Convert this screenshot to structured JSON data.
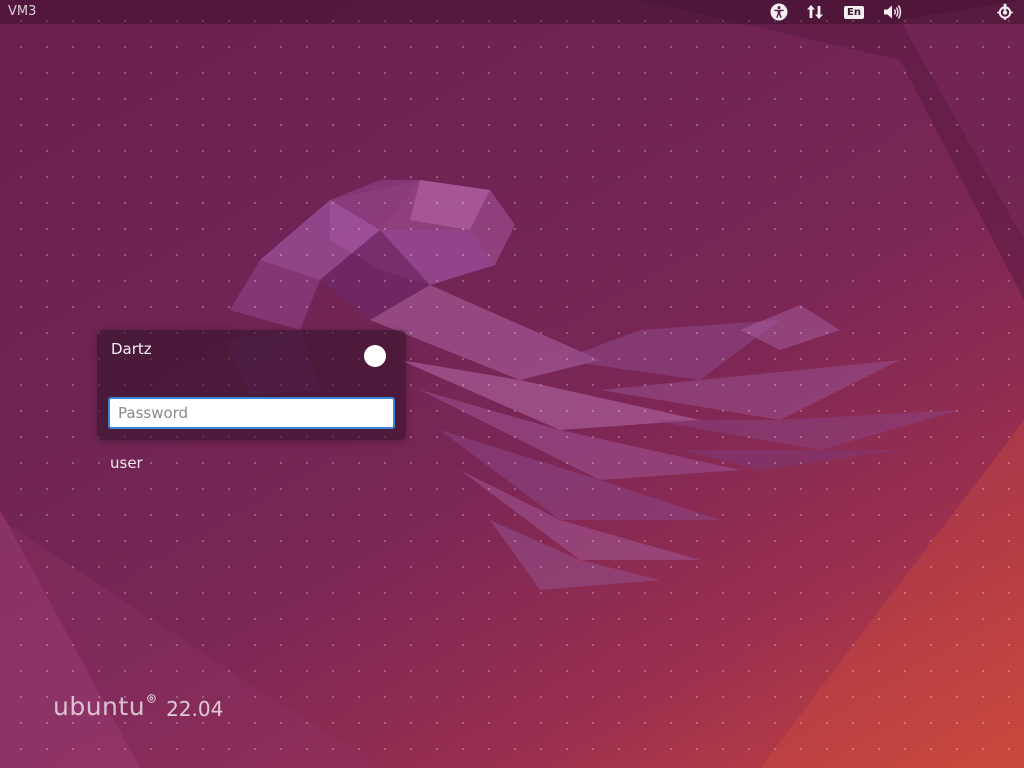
{
  "top_panel": {
    "hostname": "VM3",
    "keyboard_layout": "En",
    "icons": [
      "accessibility-icon",
      "network-icon",
      "keyboard-layout-indicator",
      "volume-icon",
      "power-icon"
    ]
  },
  "login": {
    "username": "Dartz",
    "password_placeholder": "Password",
    "password_value": "",
    "other_user_label": "user"
  },
  "branding": {
    "name": "ubuntu",
    "version": "22.04"
  },
  "colors": {
    "background_top": "#6a1f4f",
    "background_bottom": "#c9443c",
    "focus_border": "#3c84d6",
    "panel_text": "#e8dde4"
  }
}
